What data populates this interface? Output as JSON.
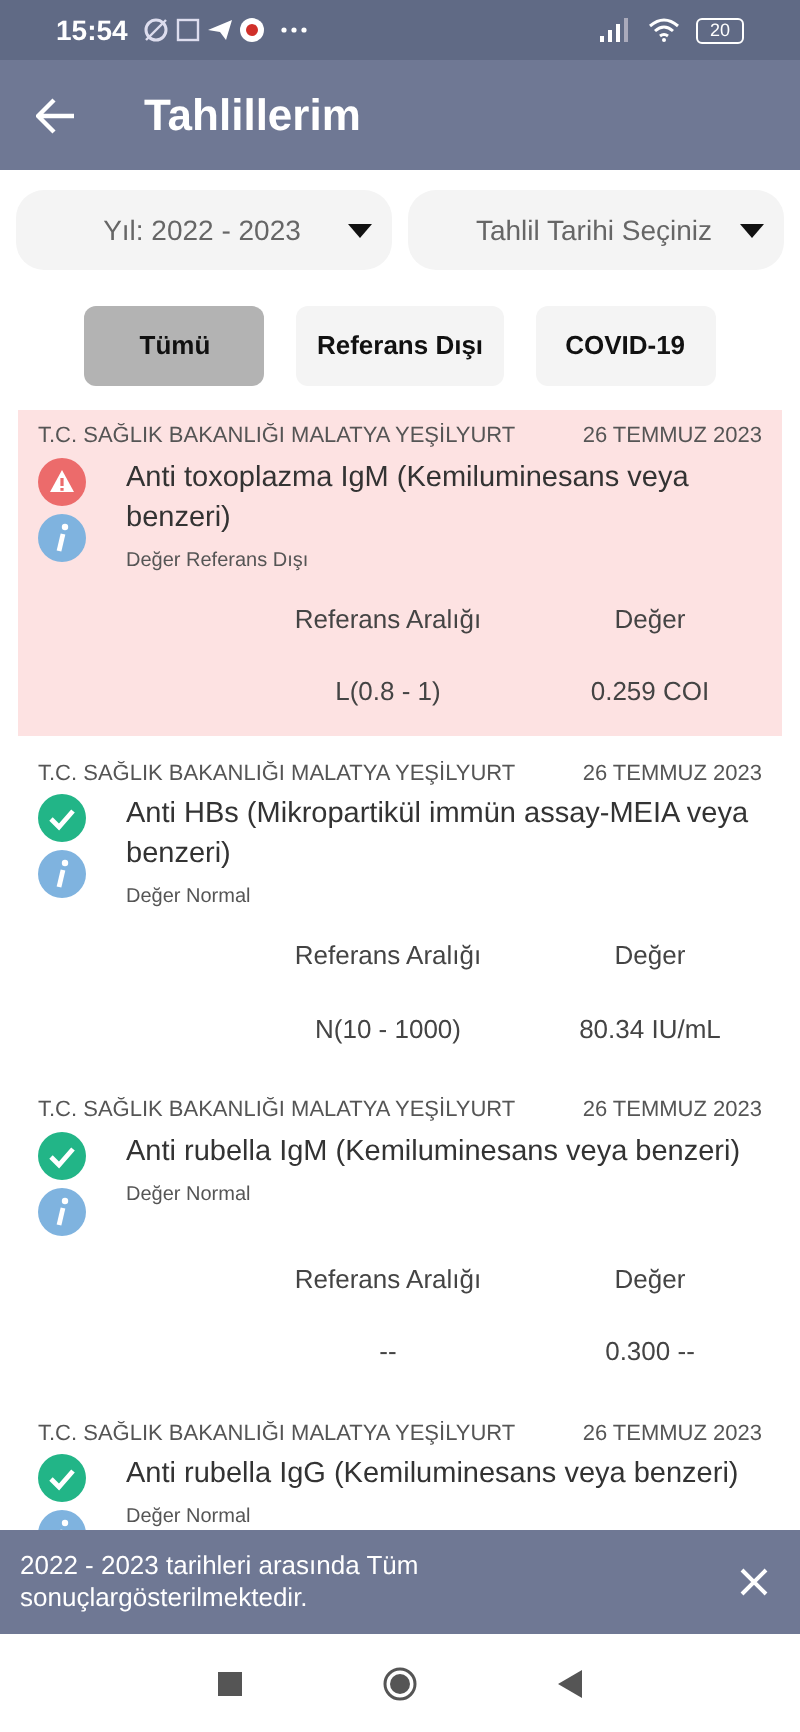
{
  "status_bar": {
    "time": "15:54",
    "battery": "20"
  },
  "app_bar": {
    "title": "Tahlillerim"
  },
  "dropdowns": [
    {
      "value": "Yıl: 2022 - 2023"
    },
    {
      "value": "Tahlil Tarihi Seçiniz"
    }
  ],
  "filters": [
    {
      "label": "Tümü",
      "selected": true
    },
    {
      "label": "Referans Dışı",
      "selected": false
    },
    {
      "label": "COVID-19",
      "selected": false
    }
  ],
  "results": [
    {
      "kind": "abnormal",
      "source": "T.C. SAĞLIK BAKANLIĞI MALATYA YEŞİLYURT",
      "date": "26 TEMMUZ 2023",
      "title": "Anti toxoplazma IgM (Kemiluminesans veya benzeri)",
      "status": "Değer Referans Dışı",
      "reference": {
        "range_label": "Referans Aralığı",
        "value_label": "Değer",
        "range": "L(0.8 - 1)",
        "value": "0.259 COI"
      }
    },
    {
      "kind": "normal",
      "source": "T.C. SAĞLIK BAKANLIĞI MALATYA YEŞİLYURT",
      "date": "26 TEMMUZ 2023",
      "title": "Anti HBs (Mikropartikül immün assay-MEIA veya benzeri)",
      "status": "Değer Normal",
      "reference": {
        "range_label": "Referans Aralığı",
        "value_label": "Değer",
        "range": "N(10 - 1000)",
        "value": "80.34 IU/mL"
      }
    },
    {
      "kind": "normal",
      "source": "T.C. SAĞLIK BAKANLIĞI MALATYA YEŞİLYURT",
      "date": "26 TEMMUZ 2023",
      "title": "Anti rubella IgM (Kemiluminesans veya benzeri)",
      "status": "Değer Normal",
      "reference": {
        "range_label": "Referans Aralığı",
        "value_label": "Değer",
        "range": "--",
        "value": "0.300 --"
      }
    },
    {
      "kind": "normal",
      "source": "T.C. SAĞLIK BAKANLIĞI MALATYA YEŞİLYURT",
      "date": "26 TEMMUZ 2023",
      "title": "Anti rubella IgG (Kemiluminesans veya benzeri)",
      "status": "Değer Normal"
    }
  ],
  "snackbar": {
    "message": "2022 - 2023 tarihleri arasında Tüm sonuçlargösterilmektedir."
  }
}
